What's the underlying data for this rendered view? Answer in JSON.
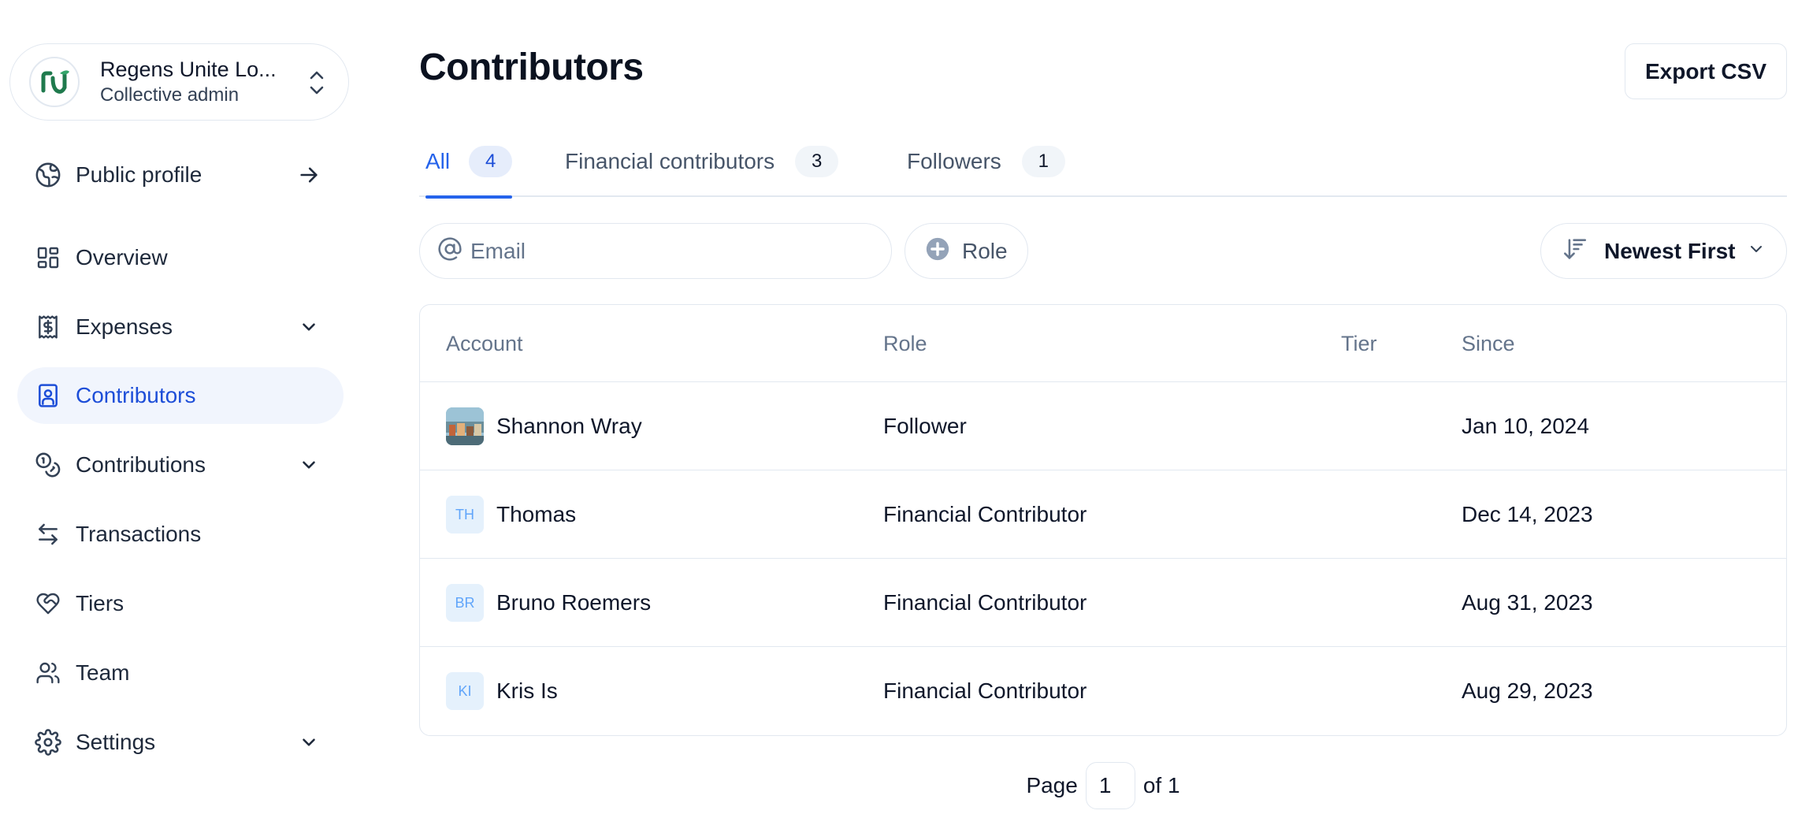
{
  "colors": {
    "accent": "#2563eb",
    "active_bg": "#f1f5fd",
    "border": "#e2e8f0",
    "muted": "#64748b",
    "logo_green": "#1f7a4d"
  },
  "account": {
    "name": "Regens Unite Lo...",
    "role": "Collective admin",
    "logo_icon": "regens-unite-logo"
  },
  "sidebar": {
    "items": [
      {
        "label": "Public profile",
        "icon": "globe-icon",
        "trail": "arrow-right-icon"
      },
      {
        "label": "Overview",
        "icon": "dashboard-icon"
      },
      {
        "label": "Expenses",
        "icon": "receipt-icon",
        "trail": "chevron-down-icon"
      },
      {
        "label": "Contributors",
        "icon": "contact-book-icon",
        "active": true
      },
      {
        "label": "Contributions",
        "icon": "coins-icon",
        "trail": "chevron-down-icon"
      },
      {
        "label": "Transactions",
        "icon": "arrows-left-right-icon"
      },
      {
        "label": "Tiers",
        "icon": "heart-handshake-icon"
      },
      {
        "label": "Team",
        "icon": "users-icon"
      },
      {
        "label": "Settings",
        "icon": "gear-icon",
        "trail": "chevron-down-icon"
      }
    ]
  },
  "main": {
    "title": "Contributors",
    "export_label": "Export CSV",
    "tabs": [
      {
        "label": "All",
        "count": "4",
        "active": true
      },
      {
        "label": "Financial contributors",
        "count": "3"
      },
      {
        "label": "Followers",
        "count": "1"
      }
    ],
    "filters": {
      "email_placeholder": "Email",
      "role_label": "Role",
      "sort_label": "Newest First"
    },
    "table": {
      "columns": [
        "Account",
        "Role",
        "Tier",
        "Since"
      ],
      "rows": [
        {
          "initials": "",
          "name": "Shannon Wray",
          "role": "Follower",
          "tier": "",
          "since": "Jan 10, 2024",
          "avatar": "photo"
        },
        {
          "initials": "TH",
          "name": "Thomas",
          "role": "Financial Contributor",
          "tier": "",
          "since": "Dec 14, 2023"
        },
        {
          "initials": "BR",
          "name": "Bruno Roemers",
          "role": "Financial Contributor",
          "tier": "",
          "since": "Aug 31, 2023"
        },
        {
          "initials": "KI",
          "name": "Kris Is",
          "role": "Financial Contributor",
          "tier": "",
          "since": "Aug 29, 2023"
        }
      ]
    },
    "pagination": {
      "page_label": "Page",
      "current_page": "1",
      "of_label": "of 1"
    }
  }
}
